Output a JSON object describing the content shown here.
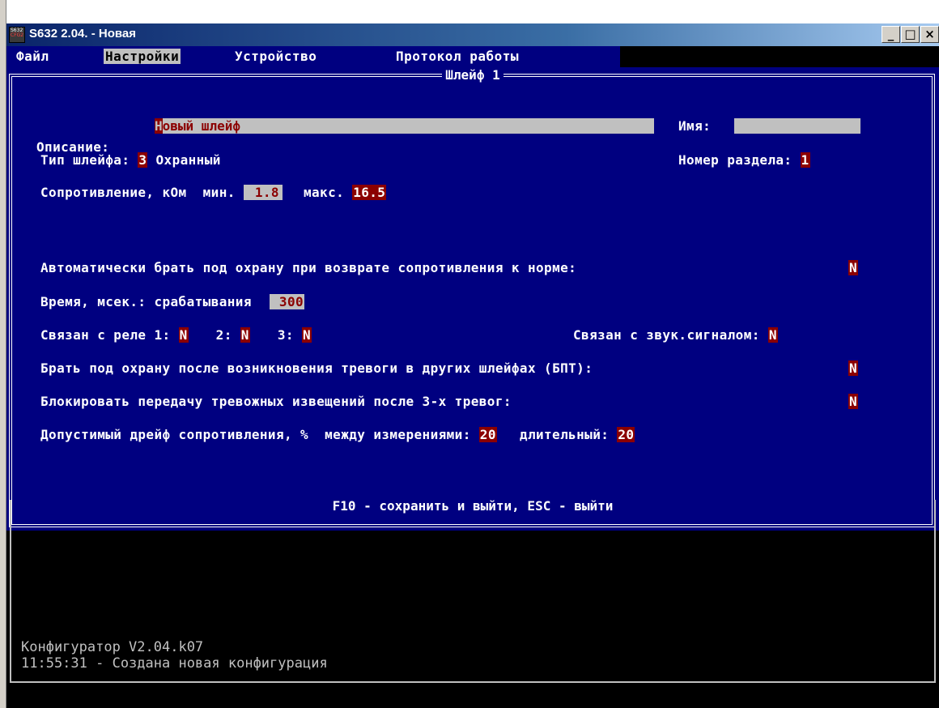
{
  "window": {
    "title": "S632 2.04. - Новая",
    "icon_text_1": "S632",
    "icon_text_2": "CFG2",
    "minimize": "_",
    "maximize": "□",
    "close": "×"
  },
  "menu": {
    "items": [
      {
        "label": "Файл",
        "active": false
      },
      {
        "label": "Настройки",
        "active": true
      },
      {
        "label": "Устройство",
        "active": false
      },
      {
        "label": "Протокол работы",
        "active": false
      }
    ]
  },
  "dialog": {
    "title": "Шлейф 1",
    "description_label": "Описание:",
    "description_first": "Н",
    "description_rest": "овый шлейф",
    "name_label": "Имя:",
    "name_value": "",
    "type_label": "Тип шлейфа:",
    "type_value": "3",
    "type_name": "Охранный",
    "section_label": "Номер раздела:",
    "section_value": "1",
    "resistance_label": "Сопротивление, кОм",
    "min_label": "мин.",
    "min_value": "1.8",
    "max_label": "макс.",
    "max_value": "16.5",
    "auto_arm_label": "Автоматически брать под охрану при возврате сопротивления к норме:",
    "auto_arm_value": "N",
    "time_label": "Время, мсек.: срабатывания",
    "time_value": "300",
    "relay_label": "Связан с реле 1:",
    "relay1_value": "N",
    "relay2_label": "2:",
    "relay2_value": "N",
    "relay3_label": "3:",
    "relay3_value": "N",
    "sound_label": "Связан с звук.сигналом:",
    "sound_value": "N",
    "bpt_label": "Брать под охрану после возникновения тревоги в других шлейфах (БПТ):",
    "bpt_value": "N",
    "block_label": "Блокировать передачу тревожных извещений после 3-х тревог:",
    "block_value": "N",
    "drift_label": "Допустимый дрейф сопротивления, %",
    "drift_between_label": "между измерениями:",
    "drift_between_value": "20",
    "drift_long_label": "длительный:",
    "drift_long_value": "20",
    "footer": "F10 - сохранить и выйти, ESC - выйти"
  },
  "log": {
    "lines": [
      "Конфигуратор V2.04.k07",
      "11:55:31 - Создана новая конфигурация"
    ]
  },
  "colors": {
    "background": "#000080",
    "field": "#c0c0c0",
    "value": "#8b0000",
    "text": "#ffffff"
  }
}
